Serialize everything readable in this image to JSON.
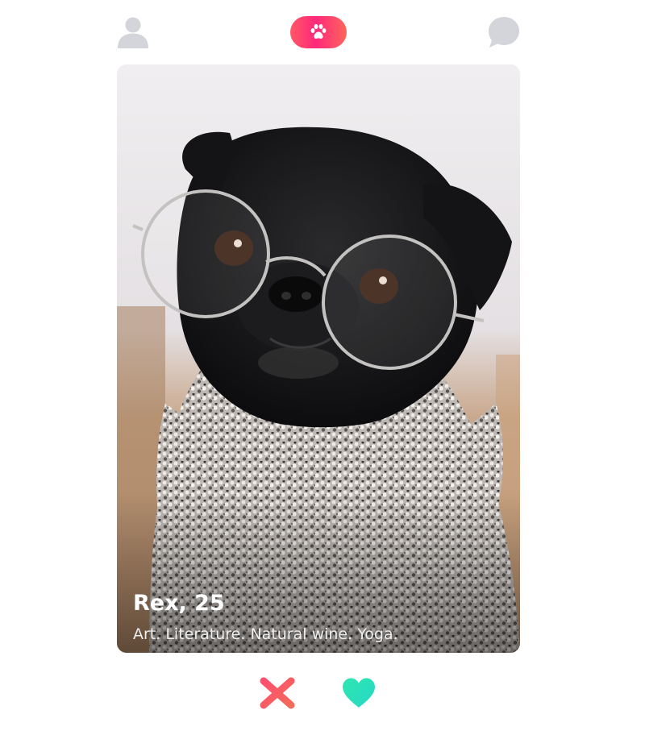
{
  "header": {
    "profile_icon": "user-icon",
    "logo_icon": "paw-icon",
    "messages_icon": "chat-bubble-icon"
  },
  "card": {
    "name_age": "Rex, 25",
    "bio": "Art. Literature. Natural wine. Yoga.",
    "photo_subject": "black pug wearing round glasses and knit scarf"
  },
  "actions": {
    "nope_icon": "close-icon",
    "like_icon": "heart-icon"
  },
  "colors": {
    "brand_gradient_start": "#fd297b",
    "brand_gradient_end": "#ff655b",
    "nope_gradient_start": "#ff4f6e",
    "nope_gradient_end": "#f26b5b",
    "like_gradient_start": "#2ee6b0",
    "like_gradient_end": "#25d9c5",
    "inactive_icon": "#d3d5db"
  }
}
